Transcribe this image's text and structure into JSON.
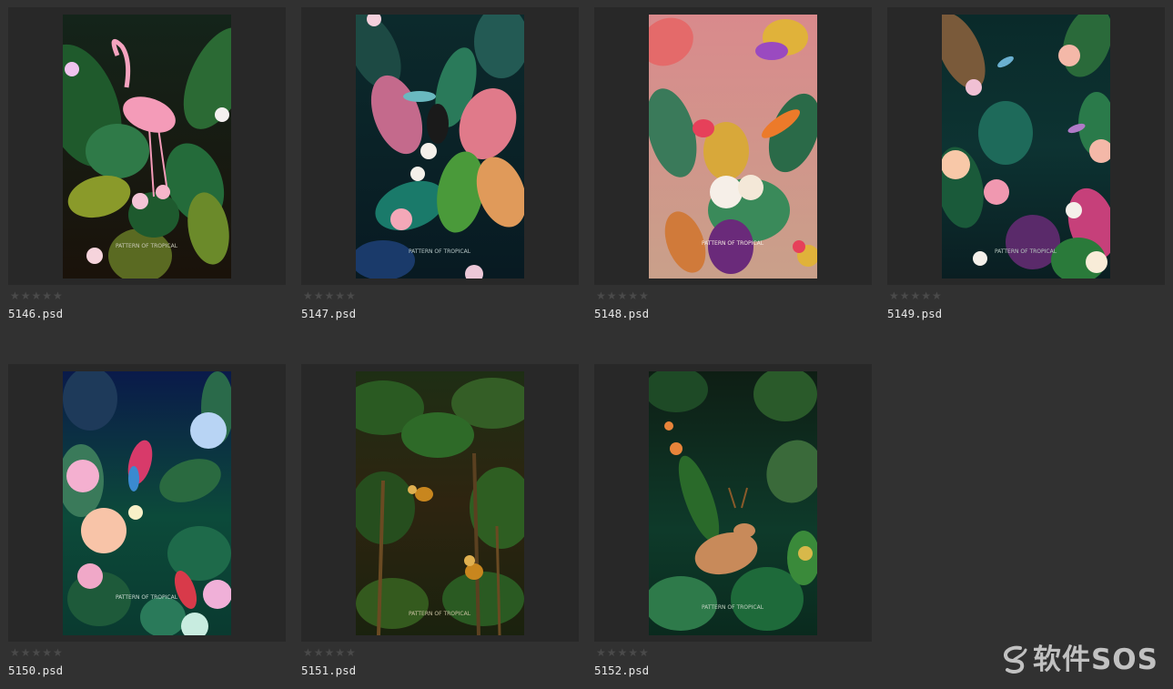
{
  "files": [
    {
      "name": "5146.psd",
      "rating": 0,
      "caption": "PATTERN OF TROPICAL"
    },
    {
      "name": "5147.psd",
      "rating": 0,
      "caption": "PATTERN OF TROPICAL"
    },
    {
      "name": "5148.psd",
      "rating": 0,
      "caption": "PATTERN OF TROPICAL"
    },
    {
      "name": "5149.psd",
      "rating": 0,
      "caption": "PATTERN OF TROPICAL"
    },
    {
      "name": "5150.psd",
      "rating": 0,
      "caption": "PATTERN OF TROPICAL"
    },
    {
      "name": "5151.psd",
      "rating": 0,
      "caption": "PATTERN OF TROPICAL"
    },
    {
      "name": "5152.psd",
      "rating": 0,
      "caption": "PATTERN OF TROPICAL"
    }
  ],
  "stars_glyphs": "★★★★★",
  "watermark": {
    "text": "软件SOS",
    "logo_icon": "swirl-logo-icon"
  },
  "colors": {
    "background": "#313131",
    "tile": "#282828",
    "text": "#e6e6e6",
    "stars": "#4a4a4a"
  }
}
